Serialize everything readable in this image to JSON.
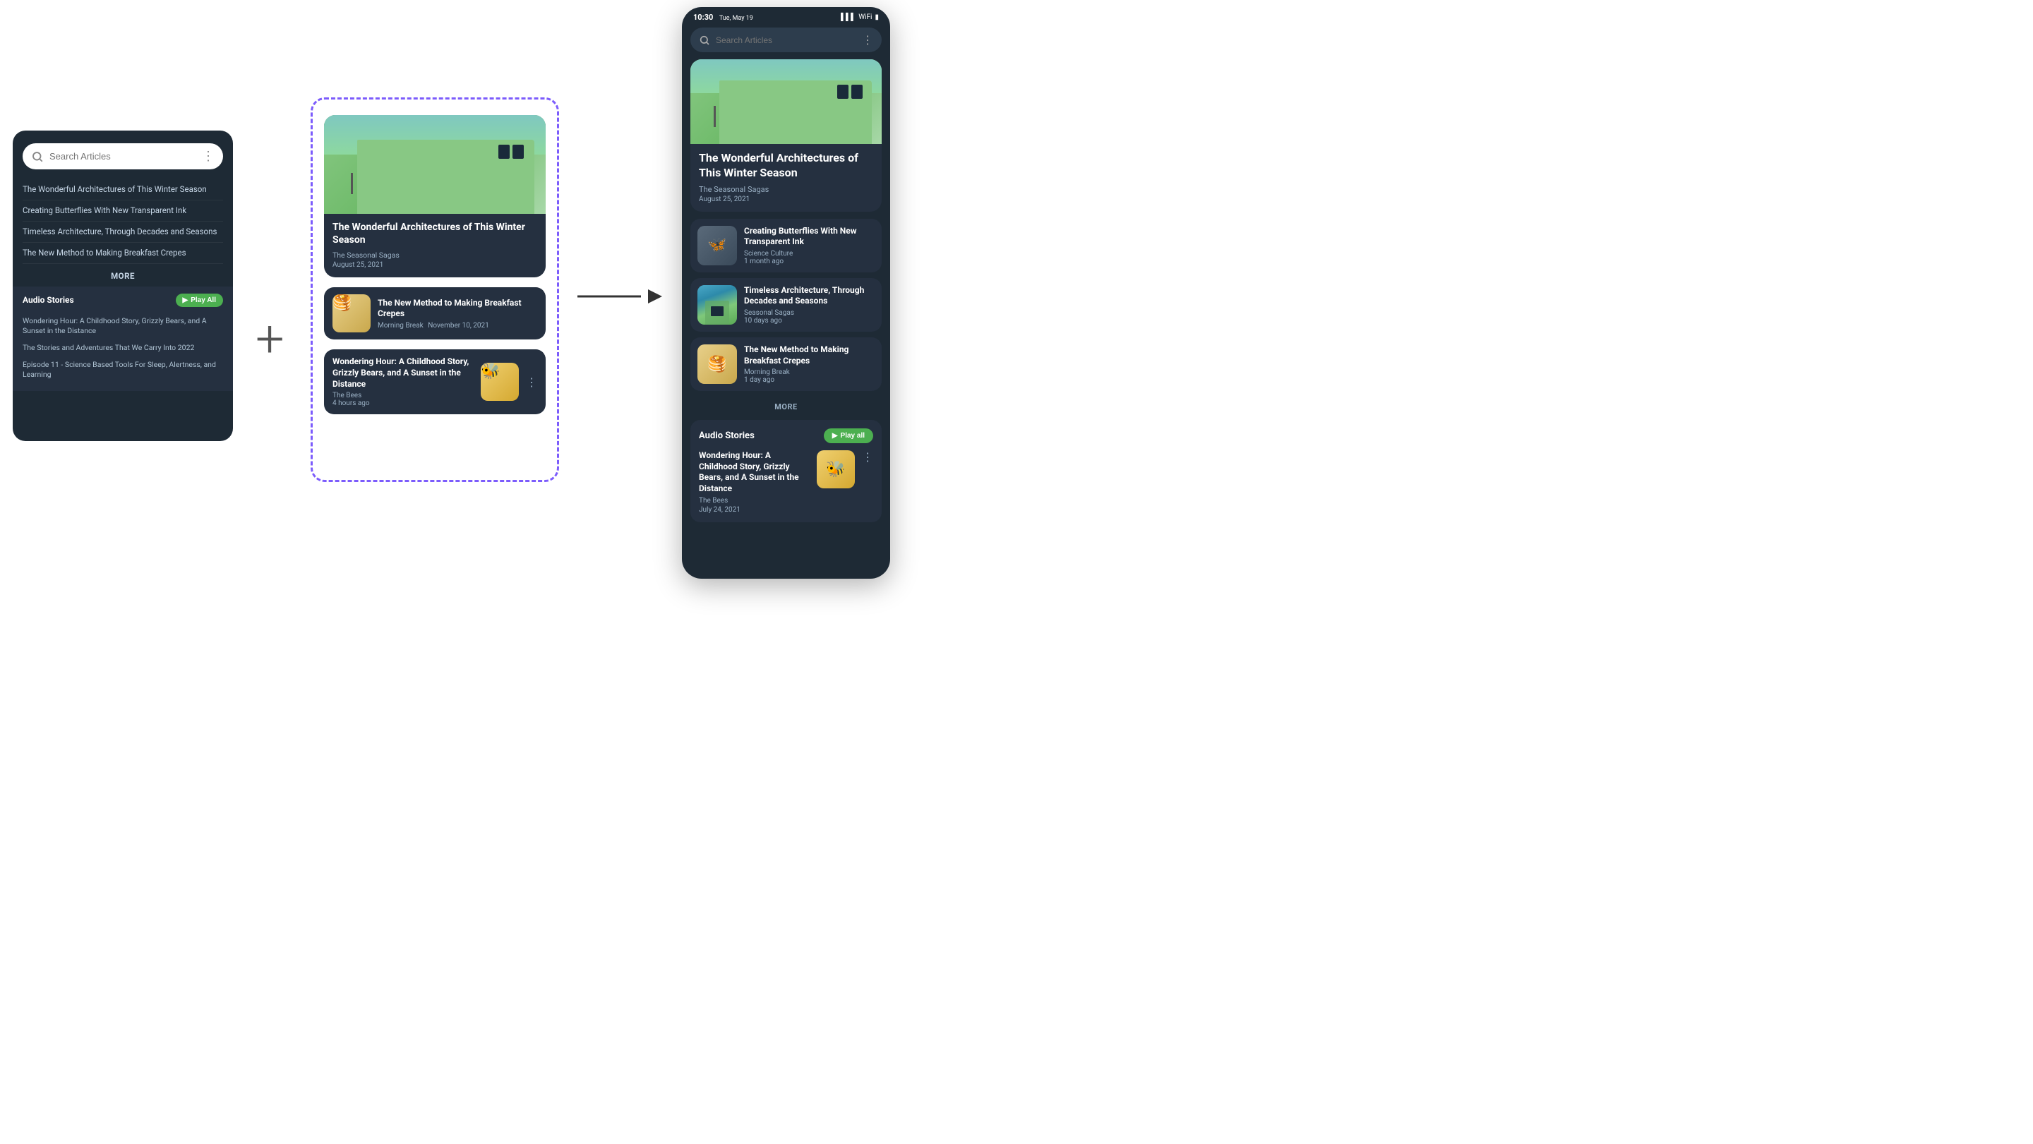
{
  "left_phone": {
    "search_placeholder": "Search Articles",
    "articles": [
      "The Wonderful Architectures of This Winter Season",
      "Creating Butterflies With New Transparent Ink",
      "Timeless Architecture, Through Decades and Seasons",
      "The New Method to Making Breakfast Crepes"
    ],
    "more_label": "MORE",
    "audio_section": {
      "title": "Audio Stories",
      "play_all_label": "Play All",
      "items": [
        "Wondering Hour: A Childhood Story, Grizzly Bears, and A Sunset in the Distance",
        "The Stories and Adventures That We Carry Into 2022",
        "Episode 11 - Science Based Tools For Sleep, Alertness, and Learning"
      ]
    }
  },
  "center_box": {
    "featured": {
      "title": "The Wonderful Architectures of This Winter Season",
      "source": "The Seasonal Sagas",
      "date": "August 25, 2021"
    },
    "cards": [
      {
        "title": "The New Method to Making Breakfast Crepes",
        "source": "Morning Break",
        "date": "November 10, 2021"
      },
      {
        "title": "Wondering Hour: A Childhood Story, Grizzly Bears, and A Sunset in the Distance",
        "source": "The Bees",
        "time": "4 hours ago"
      }
    ]
  },
  "right_phone": {
    "status_bar": {
      "time": "10:30",
      "date": "Tue, May 19"
    },
    "search_placeholder": "Search Articles",
    "featured": {
      "title": "The Wonderful Architectures of This Winter Season",
      "source": "The Seasonal Sagas",
      "date": "August 25, 2021"
    },
    "articles": [
      {
        "title": "Creating Butterflies With New Transparent Ink",
        "source": "Science Culture",
        "time": "1 month ago"
      },
      {
        "title": "Timeless Architecture, Through Decades and Seasons",
        "source": "Seasonal Sagas",
        "time": "10 days ago"
      },
      {
        "title": "The New Method to Making Breakfast Crepes",
        "source": "Morning Break",
        "time": "1 day ago"
      }
    ],
    "more_label": "MORE",
    "audio_section": {
      "title": "Audio Stories",
      "play_all_label": "Play all",
      "item": {
        "title": "Wondering Hour: A Childhood Story, Grizzly Bears, and A Sunset in the Distance",
        "source": "The Bees",
        "date": "July 24, 2021"
      }
    }
  },
  "icons": {
    "search": "🔍",
    "play": "▶",
    "dots": "⋮",
    "signal": "📶",
    "wifi": "WiFi",
    "battery": "🔋"
  }
}
